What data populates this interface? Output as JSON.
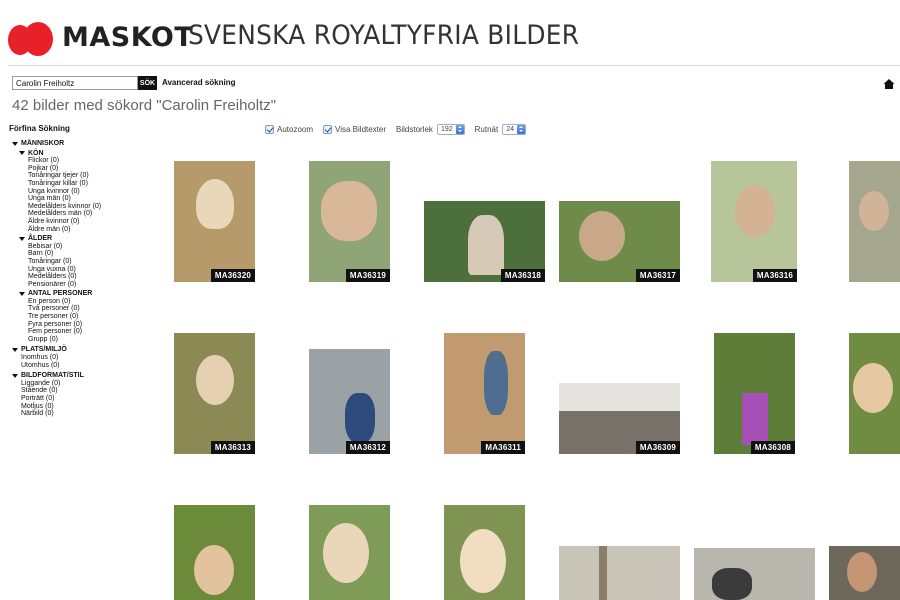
{
  "brand": {
    "name": "MASKOT",
    "tagline": "SVENSKA ROYALTYFRIA BILDER",
    "logo_color": "#e8202a"
  },
  "search": {
    "value": "Carolin Freiholtz",
    "button_label": "SÖK",
    "advanced_label": "Avancerad sökning"
  },
  "result_heading": "42 bilder med sökord \"Carolin Freiholtz\"",
  "refine": {
    "title": "Förfina Sökning",
    "categories": [
      {
        "label": "MÄNNISKOR",
        "groups": [
          {
            "label": "KÖN",
            "items": [
              "Flickor (0)",
              "Pojkar (0)",
              "Tonåringar tjejer (0)",
              "Tonåringar killar (0)",
              "Unga kvinnor (0)",
              "Unga män (0)",
              "Medelålders kvinnor (0)",
              "Medelålders män (0)",
              "Äldre kvinnor (0)",
              "Äldre män (0)"
            ]
          },
          {
            "label": "ÅLDER",
            "items": [
              "Bebisar (0)",
              "Barn (0)",
              "Tonåringar (0)",
              "Unga vuxna (0)",
              "Medelålders (0)",
              "Pensionärer (0)"
            ]
          },
          {
            "label": "ANTAL PERSONER",
            "items": [
              "En person (0)",
              "Två personer (0)",
              "Tre personer (0)",
              "Fyra personer (0)",
              "Fem personer (0)",
              "Grupp (0)"
            ]
          }
        ]
      },
      {
        "label": "PLATS/MILJÖ",
        "items": [
          "Inomhus (0)",
          "Utomhus (0)"
        ]
      },
      {
        "label": "BILDFORMAT/STIL",
        "items": [
          "Liggande (0)",
          "Stående (0)",
          "Porträtt (0)",
          "Motljus (0)",
          "Närbild (0)"
        ]
      }
    ]
  },
  "options": {
    "autozoom_label": "Autozoom",
    "autozoom_checked": true,
    "captions_label": "Visa Bildtexter",
    "captions_checked": true,
    "size_label": "Bildstorlek",
    "size_value": "192",
    "grid_label": "Rutnät",
    "grid_value": "24"
  },
  "images": [
    {
      "code": "MA36320",
      "bg": "#b79a6a",
      "subject": "#e9d7b9"
    },
    {
      "code": "MA36319",
      "bg": "#8fa477",
      "subject": "#d9b89a"
    },
    {
      "code": "MA36318",
      "bg": "#4c6f3b",
      "subject": "#d6c9b8"
    },
    {
      "code": "MA36317",
      "bg": "#6f8b4a",
      "subject": "#c9a88a"
    },
    {
      "code": "MA36316",
      "bg": "#b7c59a",
      "subject": "#d4b394"
    },
    {
      "code": "",
      "bg": "#a4a68d",
      "subject": "#d1b397"
    },
    {
      "code": "MA36313",
      "bg": "#8b8a55",
      "subject": "#e6d0b2"
    },
    {
      "code": "MA36312",
      "bg": "#9aa2a5",
      "subject": "#2f4b7d"
    },
    {
      "code": "MA36311",
      "bg": "#c19b6f",
      "subject": "#4f6d8f"
    },
    {
      "code": "MA36309",
      "bg": "#e6e4df",
      "subject": "#777169"
    },
    {
      "code": "MA36308",
      "bg": "#5d7d38",
      "subject": "#a64fb4"
    },
    {
      "code": "",
      "bg": "#6f8c42",
      "subject": "#e6c9a2"
    },
    {
      "code": "",
      "bg": "#6b8a3a",
      "subject": "#e2c39e"
    },
    {
      "code": "",
      "bg": "#7e9c57",
      "subject": "#ead6b9"
    },
    {
      "code": "",
      "bg": "#7f9453",
      "subject": "#f0ddc2"
    },
    {
      "code": "",
      "bg": "#c8c5b8",
      "subject": "#8a7f68"
    },
    {
      "code": "",
      "bg": "#b9b6ad",
      "subject": "#3a3a3a"
    },
    {
      "code": "",
      "bg": "#6d675c",
      "subject": "#c49674"
    }
  ]
}
